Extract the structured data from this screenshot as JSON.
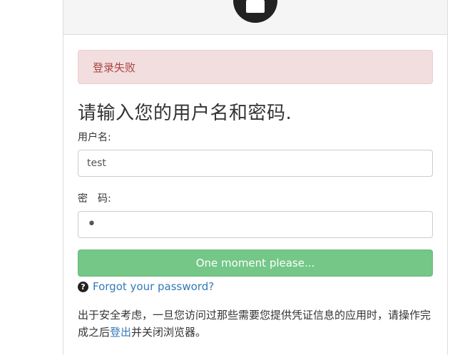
{
  "alert": {
    "message": "登录失败"
  },
  "form": {
    "heading": "请输入您的用户名和密码.",
    "username_label": "用户名:",
    "username_value": "test",
    "password_label": "密　码:",
    "password_masked": "•",
    "submit_label": "One moment please..."
  },
  "forgot": {
    "link_label": "Forgot your password?"
  },
  "note": {
    "before_link": "出于安全考虑，一旦您访问过那些需要您提供凭证信息的应用时，请操作完成之后",
    "link_label": "登出",
    "after_link": "并关闭浏览器。"
  },
  "icons": {
    "header": "lock-icon",
    "help": "question-circle-icon"
  },
  "colors": {
    "alert_bg": "#f2dede",
    "alert_text": "#a94442",
    "button": "#74c786",
    "link": "#337ab7"
  }
}
